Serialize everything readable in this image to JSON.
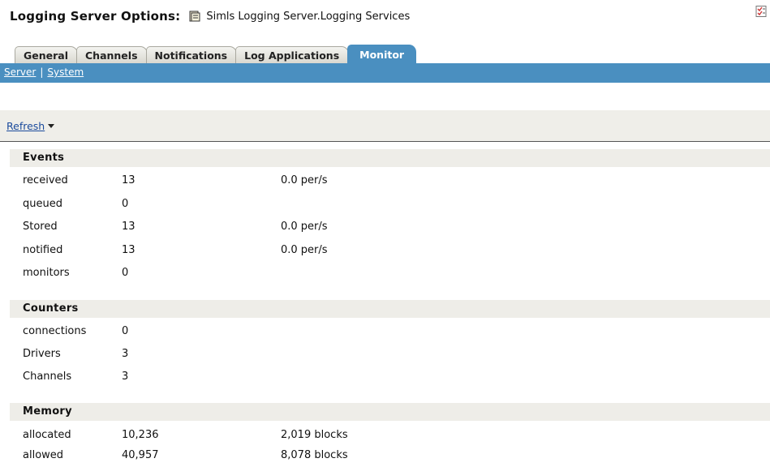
{
  "header": {
    "title_label": "Logging Server Options:",
    "object_name": "Simls Logging Server.Logging Services"
  },
  "tabs": [
    {
      "label": "General"
    },
    {
      "label": "Channels"
    },
    {
      "label": "Notifications"
    },
    {
      "label": "Log Applications"
    },
    {
      "label": "Monitor",
      "active": true
    }
  ],
  "subnav": {
    "server": "Server",
    "separator": "|",
    "system": "System"
  },
  "toolbar": {
    "refresh": "Refresh"
  },
  "sections": {
    "events": {
      "title": "Events",
      "rows": [
        {
          "name": "received",
          "value": "13",
          "rate": "0.0 per/s"
        },
        {
          "name": "queued",
          "value": "0",
          "rate": ""
        },
        {
          "name": "Stored",
          "value": "13",
          "rate": "0.0 per/s"
        },
        {
          "name": "notified",
          "value": "13",
          "rate": "0.0 per/s"
        },
        {
          "name": "monitors",
          "value": "0",
          "rate": ""
        }
      ]
    },
    "counters": {
      "title": "Counters",
      "rows": [
        {
          "name": "connections",
          "value": "0"
        },
        {
          "name": "Drivers",
          "value": "3"
        },
        {
          "name": "Channels",
          "value": "3"
        }
      ]
    },
    "memory": {
      "title": "Memory",
      "rows": [
        {
          "name": "allocated",
          "value": "10,236",
          "blocks": "2,019 blocks"
        },
        {
          "name": "allowed",
          "value": "40,957",
          "blocks": "8,078 blocks"
        }
      ]
    }
  },
  "colors": {
    "accent": "#4a8fc0",
    "section_bg": "#eeede8",
    "link": "#1a4a9c"
  },
  "icons": {
    "object": "server-object-icon",
    "corner": "report-icon"
  }
}
